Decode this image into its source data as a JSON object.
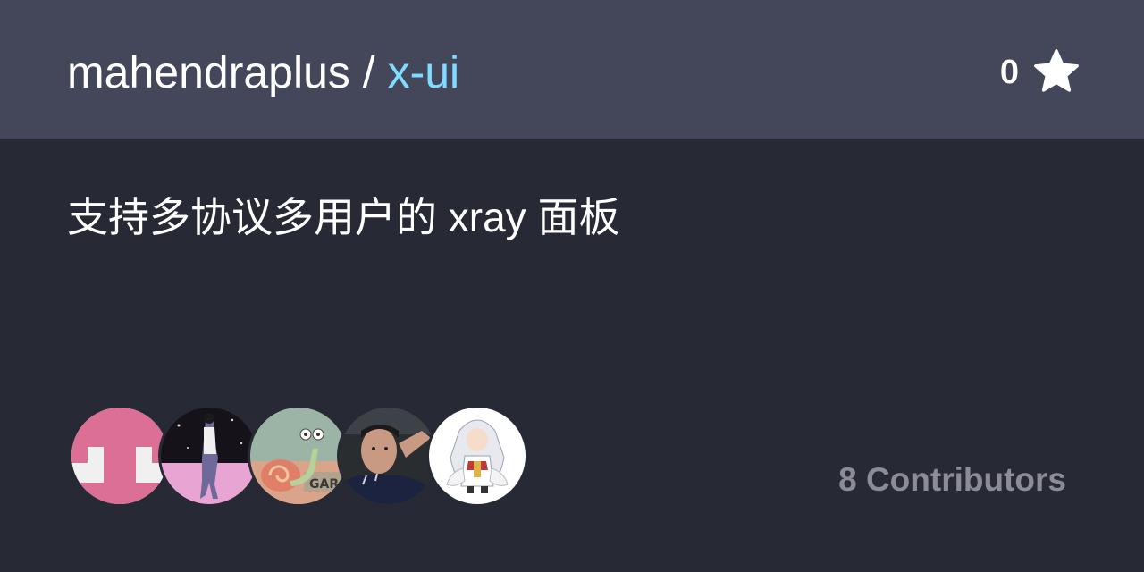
{
  "repo": {
    "owner": "mahendraplus",
    "separator": " / ",
    "name": "x-ui"
  },
  "stars": {
    "count": "0",
    "icon": "star-icon"
  },
  "description": "支持多协议多用户的 xray 面板",
  "contributors": {
    "label": "8 Contributors",
    "avatars": [
      "avatar-1",
      "avatar-2",
      "avatar-3",
      "avatar-4",
      "avatar-5"
    ]
  },
  "colors": {
    "header_bg": "#444659",
    "body_bg": "#272935",
    "repo_name": "#7fdbff",
    "contributors_text": "#8b8c95"
  }
}
